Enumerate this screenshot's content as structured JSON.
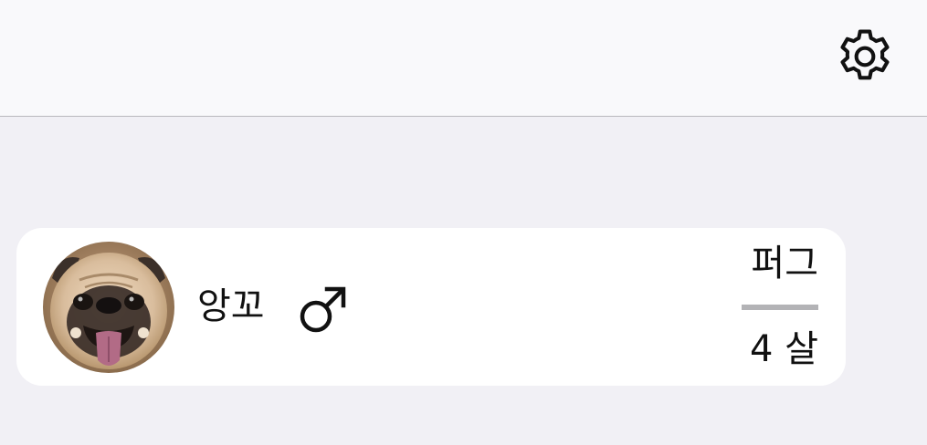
{
  "navbar": {
    "settings_icon": "gear-icon"
  },
  "pet": {
    "name": "앙꼬",
    "gender_symbol": "♂",
    "gender_icon": "male-icon",
    "breed": "퍼그",
    "age": "4 살",
    "avatar_icon": "pug-photo"
  },
  "colors": {
    "background": "#f1f0f5",
    "navbar": "#f9f9fb",
    "card": "#ffffff",
    "divider": "#b3b3b6"
  }
}
